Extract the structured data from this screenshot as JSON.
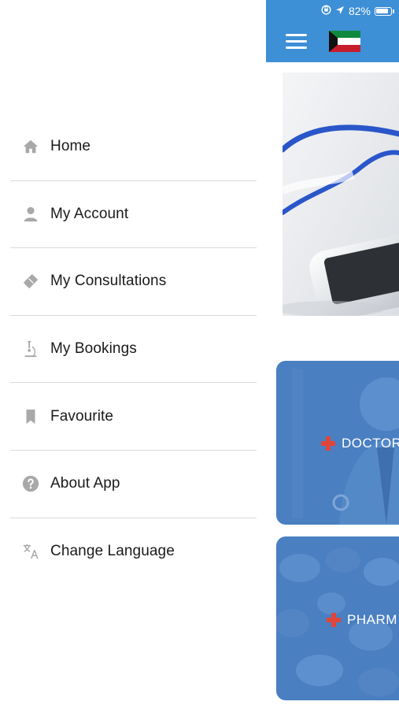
{
  "status_bar": {
    "battery_percent": "82%",
    "icons": [
      "screen-rotation-lock-icon",
      "location-arrow-icon",
      "battery-icon"
    ]
  },
  "header": {
    "menu_icon": "hamburger-icon",
    "flag": "kuwait-flag"
  },
  "drawer": {
    "items": [
      {
        "label": "Home",
        "icon": "home-icon"
      },
      {
        "label": "My Account",
        "icon": "user-icon"
      },
      {
        "label": "My Consultations",
        "icon": "ticket-icon"
      },
      {
        "label": "My Bookings",
        "icon": "microscope-icon"
      },
      {
        "label": "Favourite",
        "icon": "bookmark-icon"
      },
      {
        "label": "About App",
        "icon": "question-circle-icon"
      },
      {
        "label": "Change Language",
        "icon": "translate-icon"
      }
    ]
  },
  "cards": [
    {
      "label": "DOCTOR",
      "icon": "plus-icon"
    },
    {
      "label": "PHARM",
      "icon": "plus-icon"
    }
  ],
  "colors": {
    "header_blue": "#3d8fd6",
    "card_blue": "#4a7fc1",
    "plus_red": "#e0453a",
    "icon_gray": "#a8a8a8",
    "divider": "#d9d9d9"
  }
}
